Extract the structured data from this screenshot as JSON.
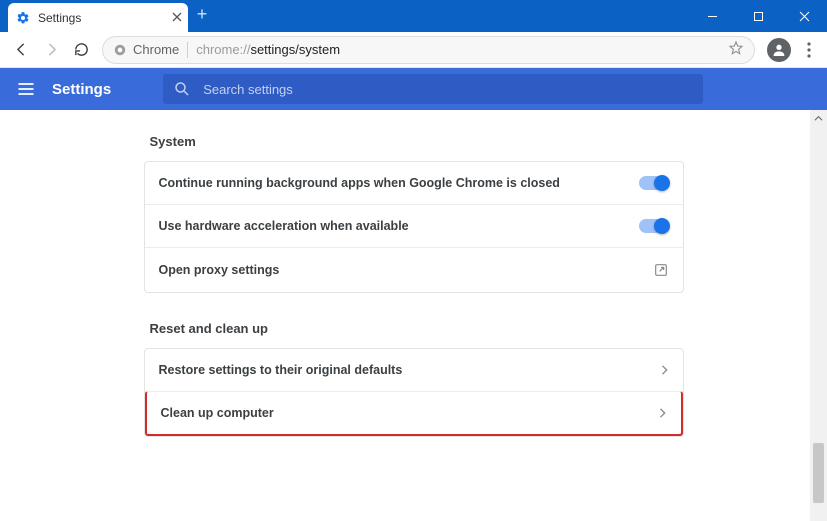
{
  "window": {
    "tab_title": "Settings"
  },
  "address": {
    "chip_label": "Chrome",
    "url_muted": "chrome://",
    "url_path": "settings/system"
  },
  "appbar": {
    "title": "Settings",
    "search_placeholder": "Search settings"
  },
  "sections": {
    "system": {
      "title": "System",
      "rows": {
        "bg_apps": "Continue running background apps when Google Chrome is closed",
        "hw_accel": "Use hardware acceleration when available",
        "proxy": "Open proxy settings"
      }
    },
    "reset": {
      "title": "Reset and clean up",
      "rows": {
        "restore": "Restore settings to their original defaults",
        "cleanup": "Clean up computer"
      }
    }
  }
}
